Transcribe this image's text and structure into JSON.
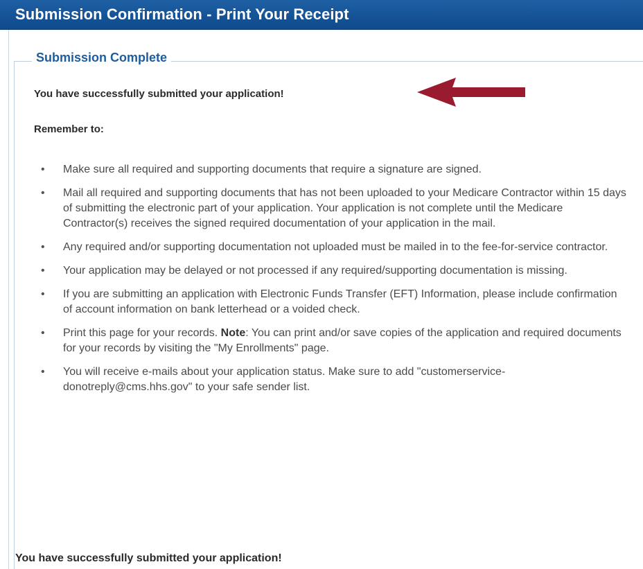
{
  "header": {
    "title": "Submission Confirmation - Print Your Receipt"
  },
  "section": {
    "legend": "Submission Complete",
    "success_message": "You have successfully submitted your application!",
    "remember_label": "Remember to:"
  },
  "bullets": [
    {
      "text": "Make sure all required and supporting documents that require a signature are signed."
    },
    {
      "text": "Mail all required and supporting documents that has not been uploaded to your Medicare Contractor within 15 days of submitting the electronic part of your application. Your application is not complete until the Medicare Contractor(s) receives the signed required documentation of your application in the mail."
    },
    {
      "text": "Any required and/or supporting documentation not uploaded must be mailed in to the fee-for-service contractor."
    },
    {
      "text": "Your application may be delayed or not processed if any required/supporting documentation is missing."
    },
    {
      "text": "If you are submitting an application with Electronic Funds Transfer (EFT) Information, please include confirmation of account information on bank letterhead or a voided check."
    },
    {
      "text_before": "Print this page for your records. ",
      "note_label": "Note",
      "text_after": ": You can print and/or save copies of the application and required documents for your records by visiting the \"My Enrollments\" page."
    },
    {
      "text": "You will receive e-mails about your application status. Make sure to add \"customerservice-donotreply@cms.hhs.gov\" to your safe sender list."
    }
  ],
  "footer_message": "You have successfully submitted your application!",
  "bullet_glyph": "•",
  "colors": {
    "header_bg": "#1e5fa3",
    "legend_text": "#1f5c9c",
    "arrow": "#9b1b2e"
  }
}
